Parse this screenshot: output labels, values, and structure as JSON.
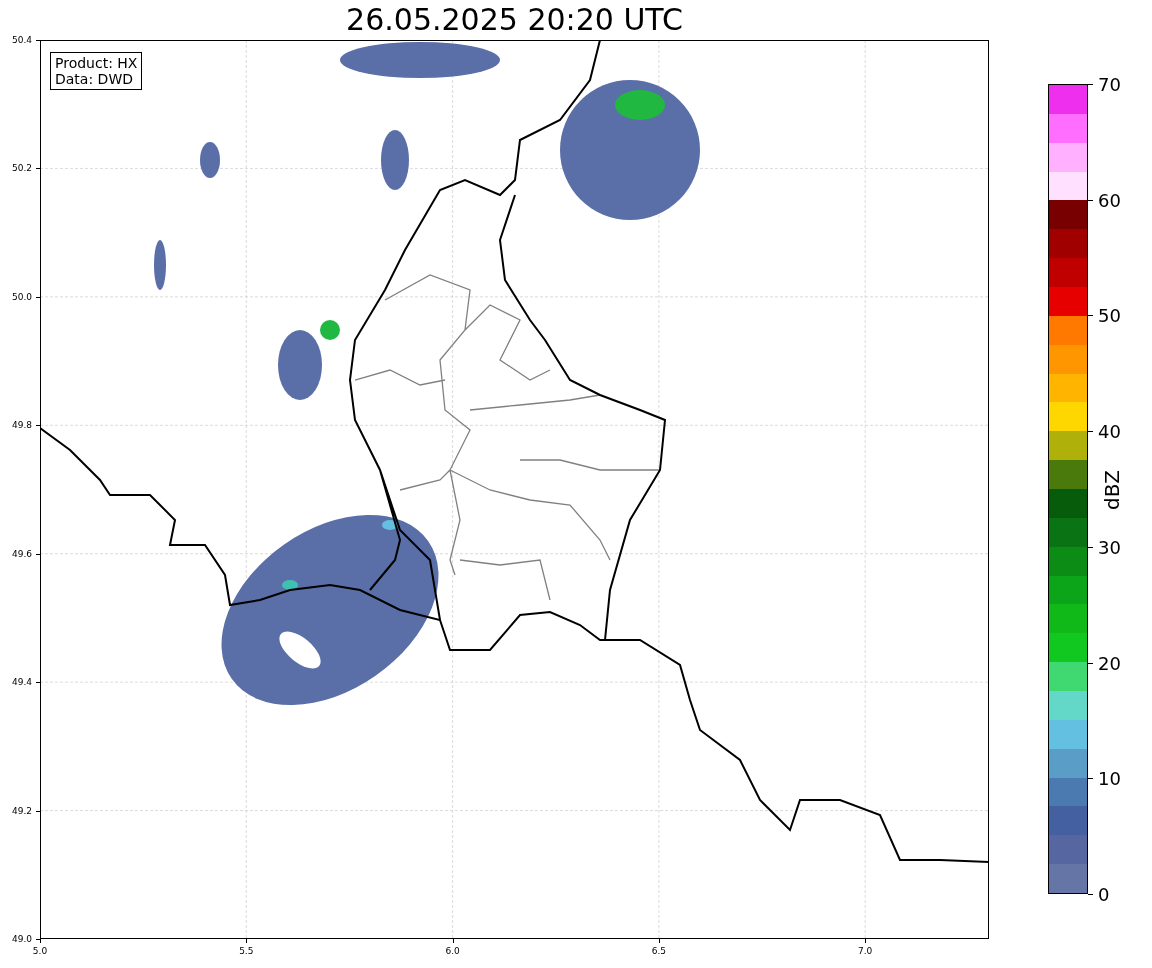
{
  "title": "26.05.2025 20:20 UTC",
  "info_box": {
    "lines": [
      "Product: HX",
      "Data: DWD"
    ]
  },
  "map": {
    "kind": "map",
    "y_ticks": [
      "50.4",
      "50.2",
      "50.0",
      "49.8",
      "49.6",
      "49.4",
      "49.2",
      "49.0"
    ],
    "x_ticks": [
      "5.0",
      "5.5",
      "6.0",
      "6.5",
      "7.0"
    ]
  },
  "colorbar": {
    "label": "dBZ",
    "ticks": [
      "70",
      "60",
      "50",
      "40",
      "30",
      "20",
      "10",
      "0"
    ],
    "bins": [
      {
        "color": "#ee30ee"
      },
      {
        "color": "#ff6eff"
      },
      {
        "color": "#ffb0ff"
      },
      {
        "color": "#ffe0ff"
      },
      {
        "color": "#780000"
      },
      {
        "color": "#a00000"
      },
      {
        "color": "#c00000"
      },
      {
        "color": "#e60000"
      },
      {
        "color": "#ff7800"
      },
      {
        "color": "#ff9600"
      },
      {
        "color": "#ffb400"
      },
      {
        "color": "#ffd700"
      },
      {
        "color": "#b0b00a"
      },
      {
        "color": "#4a7a0c"
      },
      {
        "color": "#075c0c"
      },
      {
        "color": "#0a7414"
      },
      {
        "color": "#0c8c14"
      },
      {
        "color": "#0ca418"
      },
      {
        "color": "#10b818"
      },
      {
        "color": "#10c820"
      },
      {
        "color": "#40d870"
      },
      {
        "color": "#64d8c8"
      },
      {
        "color": "#64c0e0"
      },
      {
        "color": "#5a9ec8"
      },
      {
        "color": "#4a7ab0"
      },
      {
        "color": "#4560a0"
      },
      {
        "color": "#5566a0"
      },
      {
        "color": "#6475a6"
      }
    ]
  }
}
